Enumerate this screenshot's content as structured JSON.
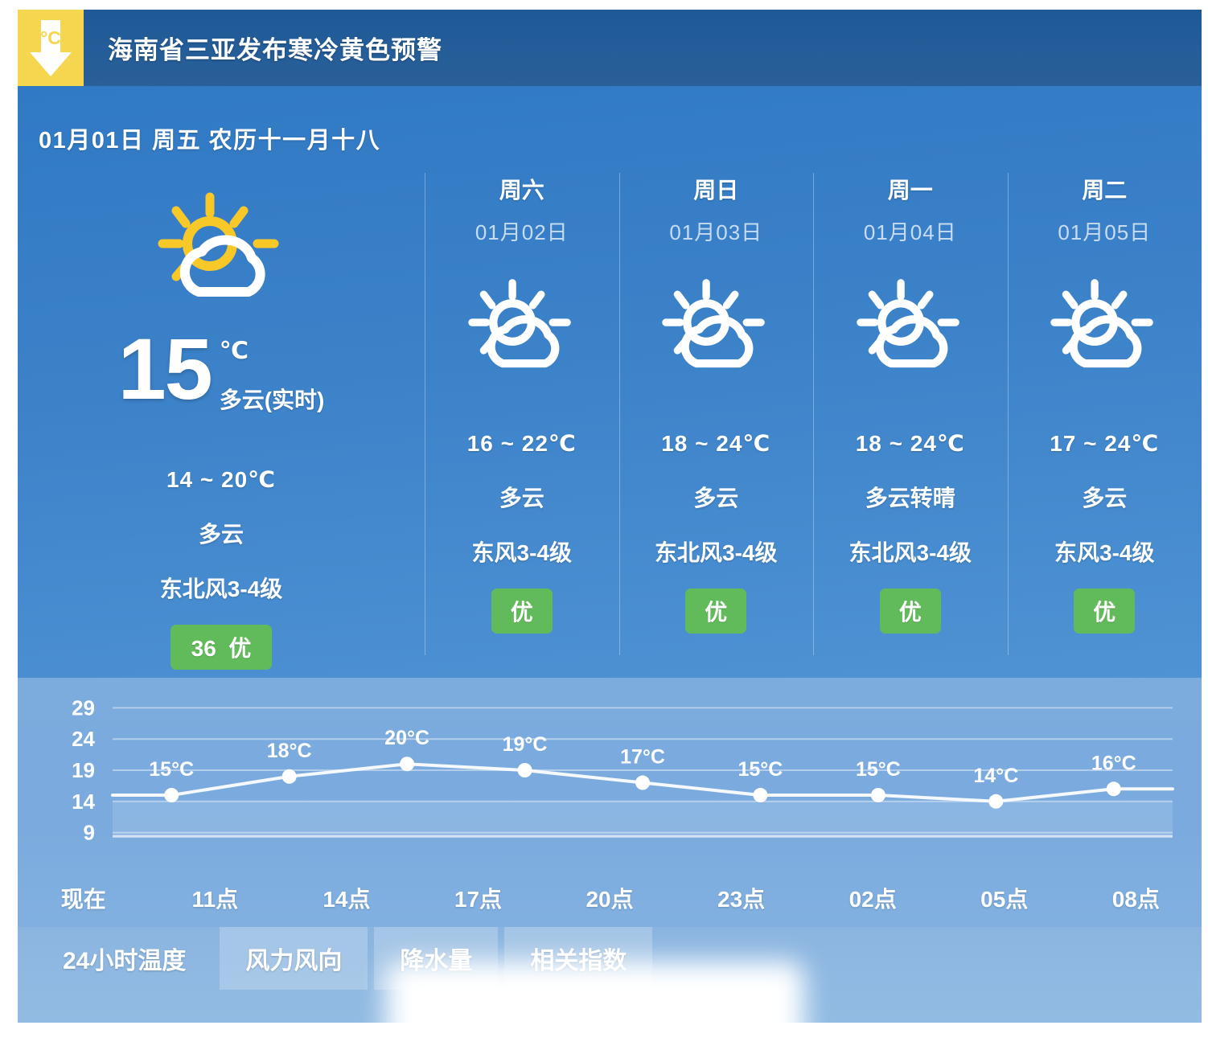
{
  "alert": {
    "icon": "cold-warning-arrow-icon",
    "icon_label": "°C",
    "title": "海南省三亚发布寒冷黄色预警",
    "bg_color": "#f5d64e",
    "bar_color": "#245d99"
  },
  "date_line": "01月01日 周五 农历十一月十八",
  "today": {
    "icon": "sun-behind-cloud-icon",
    "temp": "15",
    "unit": "℃",
    "desc": "多云(实时)",
    "range": "14 ~ 20℃",
    "condition": "多云",
    "wind": "东北风3-4级",
    "aqi_value": "36",
    "aqi_level": "优",
    "aqi_color": "#62bb5a"
  },
  "forecast": [
    {
      "day": "周六",
      "date": "01月02日",
      "icon": "sun-behind-cloud-icon",
      "range": "16 ~ 22℃",
      "condition": "多云",
      "wind": "东风3-4级",
      "aqi_level": "优"
    },
    {
      "day": "周日",
      "date": "01月03日",
      "icon": "sun-behind-cloud-icon",
      "range": "18 ~ 24℃",
      "condition": "多云",
      "wind": "东北风3-4级",
      "aqi_level": "优"
    },
    {
      "day": "周一",
      "date": "01月04日",
      "icon": "sun-behind-cloud-icon",
      "range": "18 ~ 24℃",
      "condition": "多云转晴",
      "wind": "东北风3-4级",
      "aqi_level": "优"
    },
    {
      "day": "周二",
      "date": "01月05日",
      "icon": "sun-behind-cloud-icon",
      "range": "17 ~ 24℃",
      "condition": "多云",
      "wind": "东风3-4级",
      "aqi_level": "优"
    }
  ],
  "chart_data": {
    "type": "line",
    "title": "",
    "xlabel": "",
    "ylabel": "",
    "categories": [
      "现在",
      "11点",
      "14点",
      "17点",
      "20点",
      "23点",
      "02点",
      "05点",
      "08点"
    ],
    "values": [
      15,
      18,
      20,
      19,
      17,
      15,
      15,
      14,
      16
    ],
    "point_labels": [
      "15°C",
      "18°C",
      "20°C",
      "19°C",
      "17°C",
      "15°C",
      "15°C",
      "14°C",
      "16°C"
    ],
    "yticks": [
      29,
      24,
      19,
      14,
      9
    ],
    "ylim": [
      6.5,
      31.5
    ],
    "grid": true,
    "legend": "none",
    "line_color": "#ffffff",
    "point_color": "#ffffff"
  },
  "tabs": [
    {
      "label": "24小时温度",
      "active": true
    },
    {
      "label": "风力风向",
      "active": false
    },
    {
      "label": "降水量",
      "active": false
    },
    {
      "label": "相关指数",
      "active": false
    }
  ]
}
